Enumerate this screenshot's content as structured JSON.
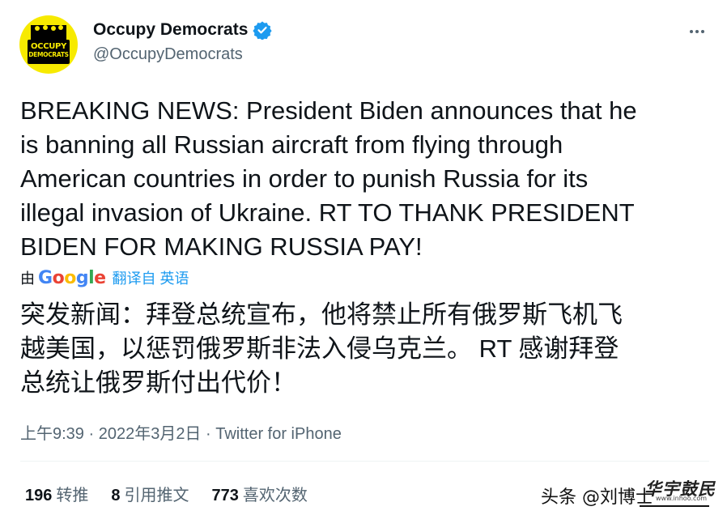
{
  "account": {
    "name": "Occupy Democrats",
    "handle": "@OccupyDemocrats",
    "avatar_text_line1": "OCCUPY",
    "avatar_text_line2": "DEMOCRATS",
    "avatar_color": "#f7ea00",
    "verified_color": "#1d9bf0"
  },
  "tweet": {
    "lines": [
      "BREAKING NEWS: President Biden announces that he",
      "is banning all Russian aircraft from flying through",
      "American countries in order to punish Russia for its",
      "illegal invasion of Ukraine. RT TO THANK PRESIDENT",
      "BIDEN FOR MAKING RUSSIA PAY!"
    ]
  },
  "translation": {
    "by_label": "由",
    "google_logo": "Google",
    "link_text": "翻译自 英语",
    "lines": [
      "突发新闻：拜登总统宣布，他将禁止所有俄罗斯飞机飞",
      "越美国，以惩罚俄罗斯非法入侵乌克兰。 RT 感谢拜登",
      "总统让俄罗斯付出代价！"
    ]
  },
  "meta": {
    "text": "上午9:39 · 2022年3月2日 · Twitter for iPhone"
  },
  "stats": [
    {
      "count": "196",
      "label": "转推"
    },
    {
      "count": "8",
      "label": "引用推文"
    },
    {
      "count": "773",
      "label": "喜欢次数"
    }
  ],
  "watermark": {
    "text": "头条 @刘博士",
    "stamp": "华宇鼓民",
    "stamp_url": "www.inhoo.com"
  }
}
